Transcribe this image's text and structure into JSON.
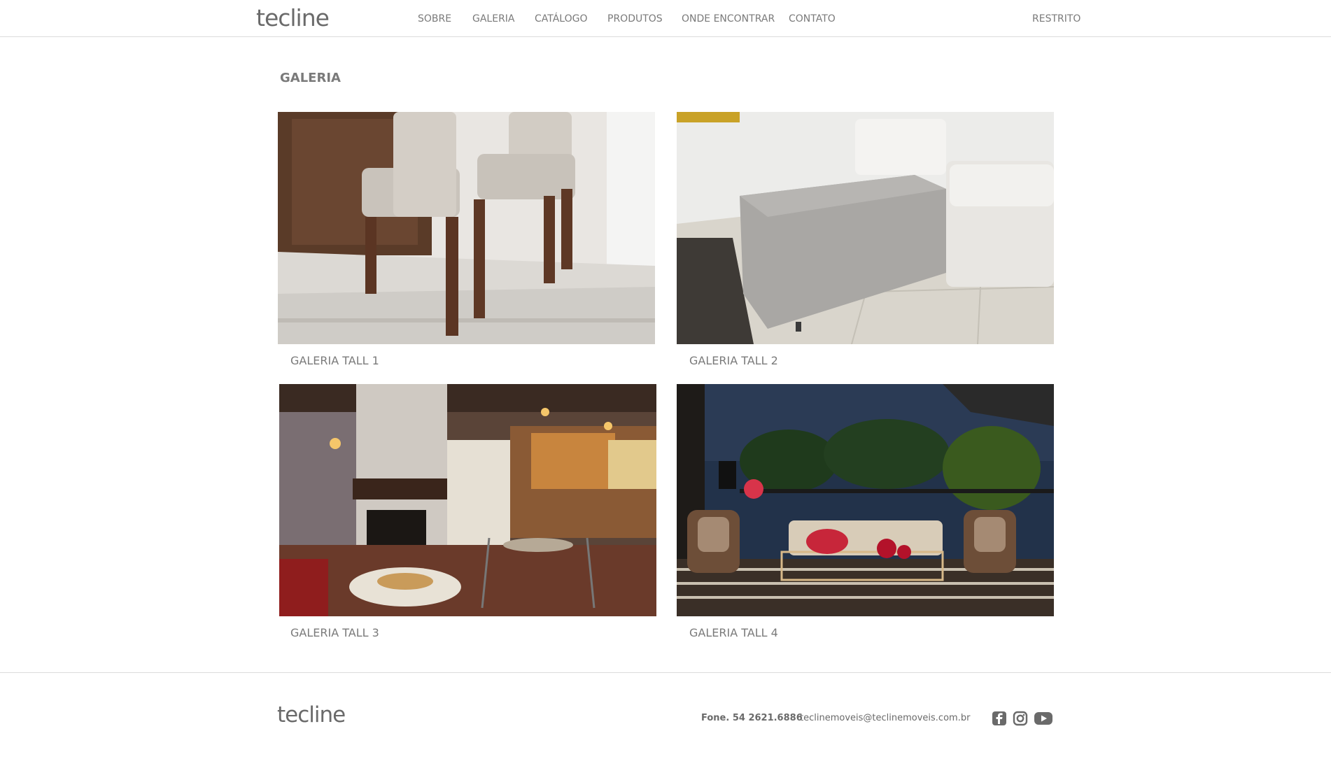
{
  "header": {
    "logo": "tecline",
    "nav": [
      "SOBRE",
      "GALERIA",
      "CATÁLOGO",
      "PRODUTOS",
      "ONDE ENCONTRAR",
      "CONTATO"
    ],
    "restricted": "RESTRITO"
  },
  "main": {
    "title": "GALERIA",
    "cards": [
      {
        "caption": "GALERIA TALL 1"
      },
      {
        "caption": "GALERIA TALL 2"
      },
      {
        "caption": "GALERIA TALL 3"
      },
      {
        "caption": "GALERIA TALL 4"
      }
    ]
  },
  "footer": {
    "logo": "tecline",
    "phone": "Fone. 54 2621.6886",
    "email": "teclinemoveis@teclinemoveis.com.br",
    "social": [
      "facebook-icon",
      "instagram-icon",
      "youtube-icon"
    ]
  }
}
